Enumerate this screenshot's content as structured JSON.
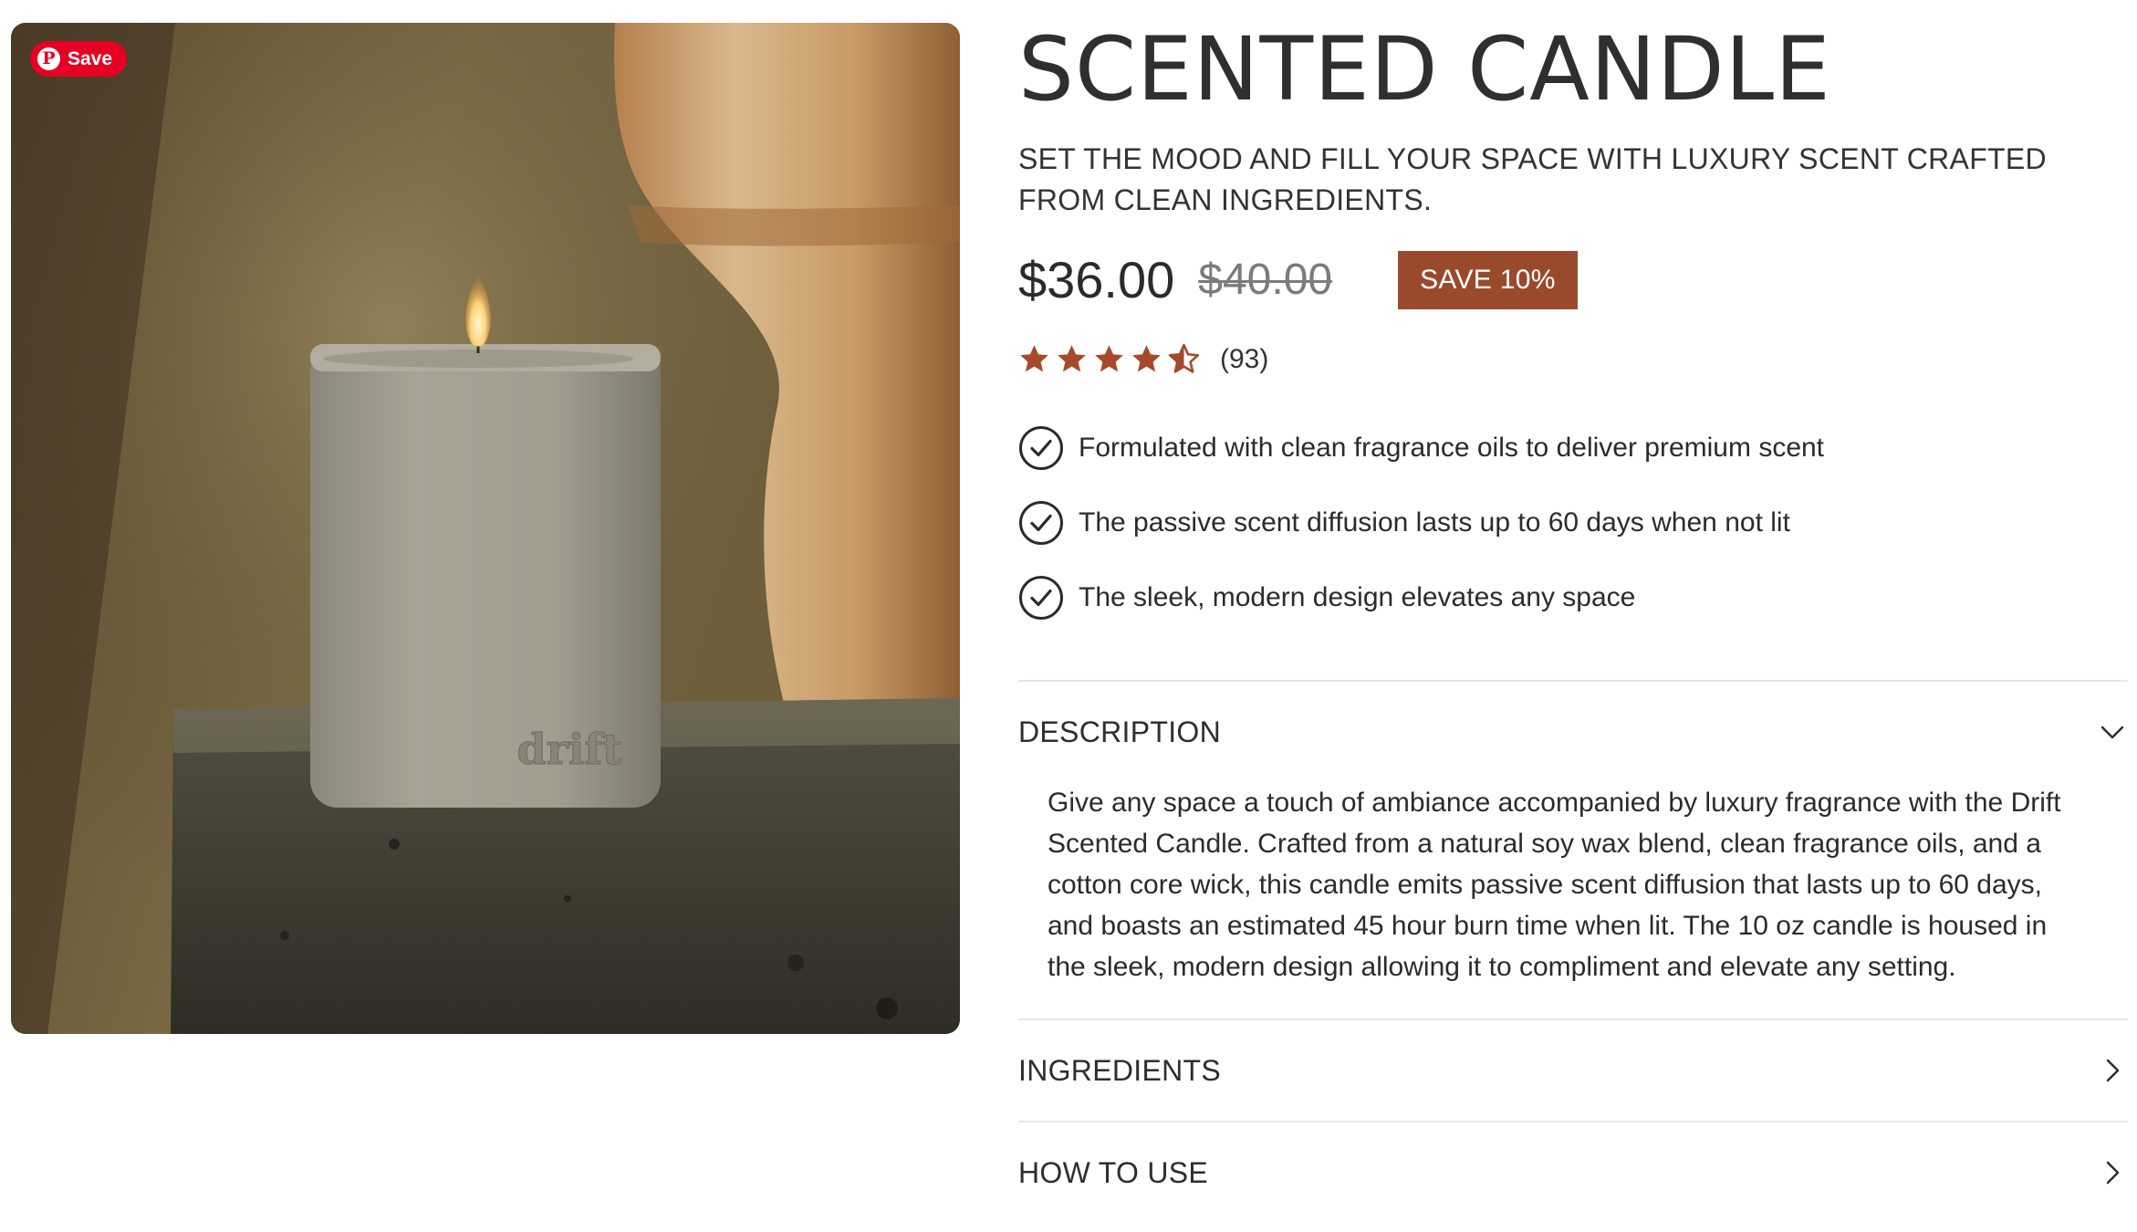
{
  "gallery": {
    "pin_button_label": "Save",
    "pin_logo": "P",
    "candle_brand_mark": "drift"
  },
  "product": {
    "title": "SCENTED CANDLE",
    "tagline": "SET THE MOOD AND FILL YOUR SPACE WITH LUXURY SCENT CRAFTED FROM CLEAN INGREDIENTS.",
    "price": "$36.00",
    "compare_price": "$40.00",
    "discount_badge": "SAVE 10%",
    "rating": {
      "value": 4.5,
      "max": 5,
      "count_label": "(93)"
    },
    "features": [
      "Formulated with clean fragrance oils to deliver premium scent",
      "The passive scent diffusion lasts up to 60 days when not lit",
      "The sleek, modern design elevates any space"
    ]
  },
  "accordion": {
    "description": {
      "title": "DESCRIPTION",
      "body": "Give any space a touch of ambiance accompanied by luxury fragrance with the Drift Scented Candle. Crafted from a natural soy wax blend, clean fragrance oils, and a cotton core wick, this candle emits passive scent diffusion that lasts up to 60 days, and boasts an estimated 45 hour burn time when lit. The 10 oz candle is housed in the sleek, modern design allowing it to compliment and elevate any setting.",
      "state": "expanded",
      "icon": "chevron-down-icon"
    },
    "ingredients": {
      "title": "INGREDIENTS",
      "state": "collapsed",
      "icon": "chevron-right-icon"
    },
    "how_to_use": {
      "title": "HOW TO USE",
      "state": "collapsed",
      "icon": "chevron-right-icon"
    }
  },
  "colors": {
    "accent": "#9a4a2c",
    "star": "#a54a2a",
    "pinterest": "#e60023",
    "text": "#2b2b2b"
  }
}
